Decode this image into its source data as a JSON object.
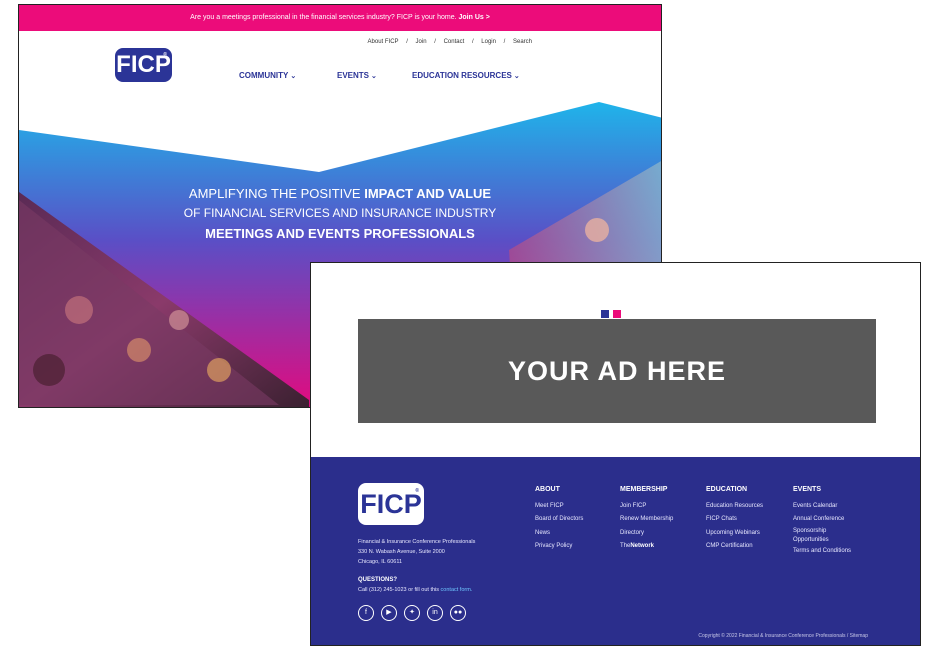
{
  "homepage": {
    "topbar": {
      "text": "Are you a meetings professional in the financial services industry? FICP is your home.",
      "join": "Join Us >"
    },
    "util_nav": [
      "About FICP",
      "/",
      "Join",
      "/",
      "Contact",
      "/",
      "Login",
      "/",
      "Search"
    ],
    "logo": "FICP",
    "main_nav": {
      "community": "COMMUNITY",
      "events": "EVENTS",
      "education": "EDUCATION RESOURCES"
    },
    "hero": {
      "line1_plain": "AMPLIFYING THE POSITIVE ",
      "line1_bold": "IMPACT AND VALUE",
      "line2": "OF FINANCIAL SERVICES AND INSURANCE INDUSTRY",
      "line3": "MEETINGS AND EVENTS PROFESSIONALS"
    }
  },
  "adpage": {
    "dot_colors": [
      "#2b3497",
      "#ec0c7a"
    ],
    "ad_label": "YOUR AD HERE",
    "footer": {
      "logo": "FICP",
      "address": [
        "Financial & Insurance Conference Professionals",
        "330 N. Wabash Avenue, Suite 2000",
        "Chicago, IL 60611"
      ],
      "questions_title": "QUESTIONS?",
      "questions_text": "Call (312) 245-1023 or fill out this ",
      "questions_link": "contact form.",
      "social_icons": [
        "facebook-icon",
        "youtube-icon",
        "twitter-icon",
        "linkedin-icon",
        "flickr-icon"
      ],
      "columns": {
        "about": {
          "head": "ABOUT",
          "items": [
            "Meet FICP",
            "Board of Directors",
            "News",
            "Privacy Policy"
          ]
        },
        "membership": {
          "head": "MEMBERSHIP",
          "items": [
            "Join FICP",
            "Renew Membership",
            "Directory"
          ],
          "network_prefix": "The",
          "network_bold": "Network"
        },
        "education": {
          "head": "EDUCATION",
          "items": [
            "Education Resources",
            "FICP Chats",
            "Upcoming Webinars",
            "CMP Certification"
          ]
        },
        "events": {
          "head": "EVENTS",
          "items": [
            "Events Calendar",
            "Annual Conference",
            "Sponsorship",
            "Opportunities",
            "Terms and Conditions"
          ]
        }
      },
      "copyright": "Copyright © 2022 Financial & Insurance Conference Professionals / Sitemap"
    }
  }
}
